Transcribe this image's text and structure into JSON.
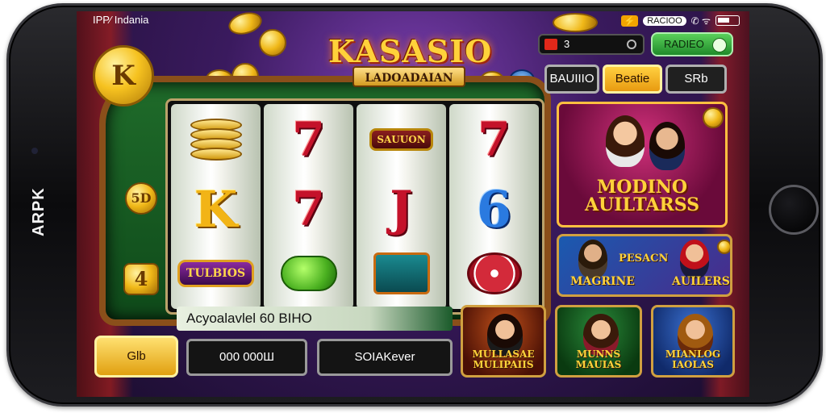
{
  "phone": {
    "side_label": "ARPK"
  },
  "status_bar": {
    "left_text": "IPP⁄ Indania",
    "right_tag": "⚡",
    "right_text": "RACIOO",
    "right_signal": "✆ ᯤ"
  },
  "logo": {
    "title": "KASASIO",
    "subtitle": "LADOADAIAN"
  },
  "coins": {
    "big_coin": "K",
    "side_coin_top": "5D",
    "side_coin_bottom": "4"
  },
  "top_bar": {
    "field_value": "3",
    "button_label": "RADIEO"
  },
  "tabs": [
    {
      "label": "BAUIIIO"
    },
    {
      "label": "Beatie"
    },
    {
      "label": "SRb"
    }
  ],
  "reels": {
    "r1_badge": "TULBIOS",
    "r2_top": "7",
    "r2_mid": "7",
    "r3_badge": "SAUUON",
    "r3_mid": "J",
    "r4_top": "7",
    "r4_mid": "6",
    "r1_mid": "K"
  },
  "promos": {
    "big_title": "MODINO AUILTARSS",
    "mid_line1": "PESACN",
    "mid_line2": "MAGRINE",
    "mid_line3": "AUILERS",
    "card1": "MULLASAE MULIPAIIS",
    "card2": "MUNNS MAUIAS",
    "card3": "MIANLOG IAOLAS"
  },
  "info_bar": {
    "text": "Acyoalavlel 60 BIHO"
  },
  "buttons": {
    "gold": "Glb",
    "dark1": "000 000Ш",
    "dark2": "SOIAKever"
  }
}
